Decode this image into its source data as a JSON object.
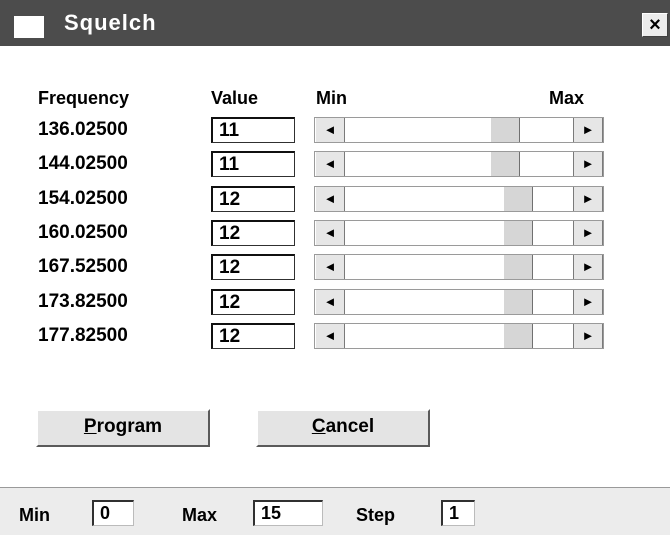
{
  "window": {
    "title": "Squelch",
    "close_label": "×"
  },
  "headers": {
    "frequency": "Frequency",
    "value": "Value",
    "min": "Min",
    "max": "Max"
  },
  "rows": [
    {
      "frequency": "136.02500",
      "value": "11"
    },
    {
      "frequency": "144.02500",
      "value": "11"
    },
    {
      "frequency": "154.02500",
      "value": "12"
    },
    {
      "frequency": "160.02500",
      "value": "12"
    },
    {
      "frequency": "167.52500",
      "value": "12"
    },
    {
      "frequency": "173.82500",
      "value": "12"
    },
    {
      "frequency": "177.82500",
      "value": "12"
    }
  ],
  "slider_range": {
    "min": 0,
    "max": 15
  },
  "buttons": {
    "program": "Program",
    "program_accel": "P",
    "program_rest": "rogram",
    "cancel": "Cancel",
    "cancel_accel": "C",
    "cancel_rest": "ancel"
  },
  "status": {
    "min_label": "Min",
    "min_value": "0",
    "max_label": "Max",
    "max_value": "15",
    "step_label": "Step",
    "step_value": "1"
  },
  "icons": {
    "left_arrow": "◄",
    "right_arrow": "►"
  }
}
